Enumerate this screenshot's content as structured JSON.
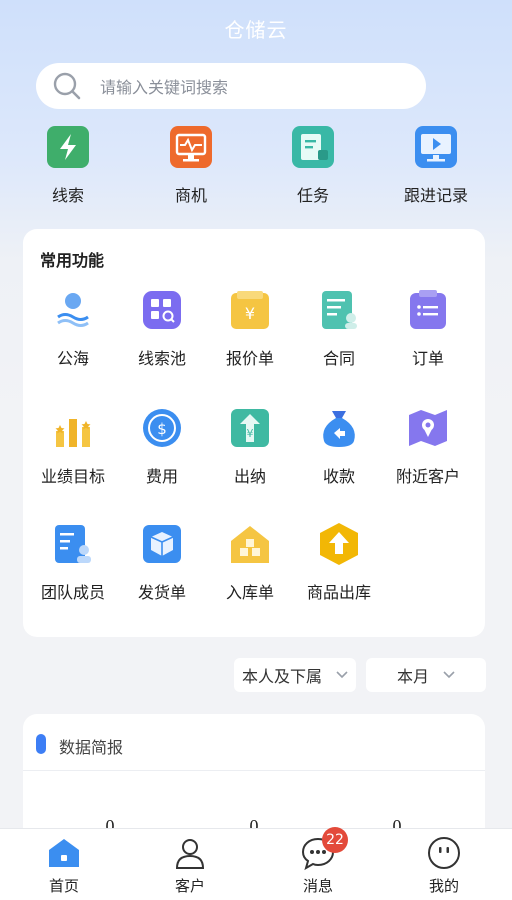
{
  "app": {
    "title": "仓储云"
  },
  "search": {
    "placeholder": "请输入关键词搜索"
  },
  "quick_actions": [
    {
      "label": "线索",
      "icon": "lightning-icon",
      "color": "#3fae6b"
    },
    {
      "label": "商机",
      "icon": "monitor-pulse-icon",
      "color": "#ee6a2c"
    },
    {
      "label": "任务",
      "icon": "task-list-icon",
      "color": "#39b8a6"
    },
    {
      "label": "跟进记录",
      "icon": "video-screen-icon",
      "color": "#3b8ef0"
    }
  ],
  "features": {
    "title": "常用功能",
    "items": [
      {
        "label": "公海",
        "icon": "sea-person-icon"
      },
      {
        "label": "线索池",
        "icon": "grid-search-icon"
      },
      {
        "label": "报价单",
        "icon": "yen-folder-icon"
      },
      {
        "label": "合同",
        "icon": "contract-icon"
      },
      {
        "label": "订单",
        "icon": "order-clipboard-icon"
      },
      {
        "label": "业绩目标",
        "icon": "bar-stars-icon"
      },
      {
        "label": "费用",
        "icon": "dollar-coin-icon"
      },
      {
        "label": "出纳",
        "icon": "yen-upload-icon"
      },
      {
        "label": "收款",
        "icon": "money-bag-icon"
      },
      {
        "label": "附近客户",
        "icon": "map-pin-icon"
      },
      {
        "label": "团队成员",
        "icon": "team-member-icon"
      },
      {
        "label": "发货单",
        "icon": "package-box-icon"
      },
      {
        "label": "入库单",
        "icon": "warehouse-icon"
      },
      {
        "label": "商品出库",
        "icon": "hexagon-up-icon"
      }
    ]
  },
  "filters": {
    "scope": "本人及下属",
    "period": "本月"
  },
  "report": {
    "title": "数据简报",
    "values": [
      "0",
      "0",
      "0"
    ]
  },
  "tabbar": {
    "items": [
      {
        "label": "首页",
        "icon": "home-icon"
      },
      {
        "label": "客户",
        "icon": "user-icon"
      },
      {
        "label": "消息",
        "icon": "chat-icon",
        "badge": "22"
      },
      {
        "label": "我的",
        "icon": "face-icon"
      }
    ]
  }
}
